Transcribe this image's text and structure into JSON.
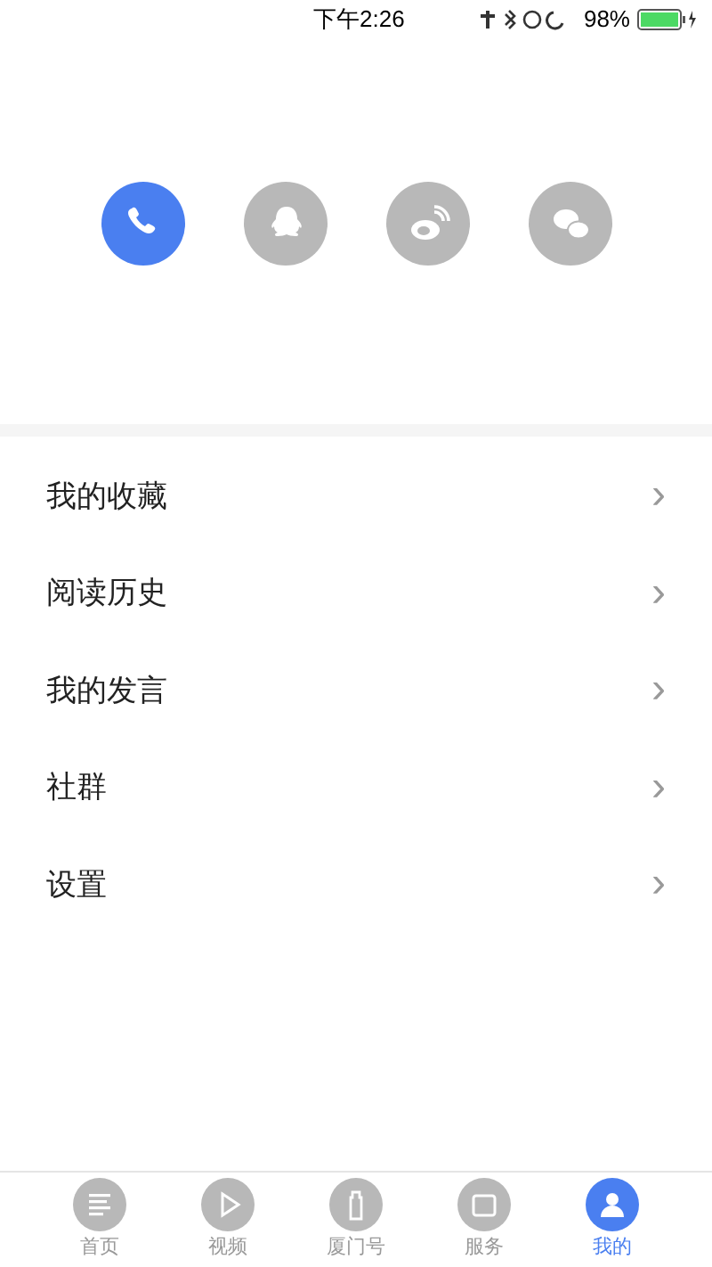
{
  "status_bar": {
    "time": "下午2:26",
    "battery": "98%"
  },
  "login_options": [
    {
      "kind": "phone",
      "selected": true
    },
    {
      "kind": "qq",
      "selected": false
    },
    {
      "kind": "weibo",
      "selected": false
    },
    {
      "kind": "wechat",
      "selected": false
    }
  ],
  "menu": [
    {
      "label": "我的收藏",
      "chevron": "›"
    },
    {
      "label": "阅读历史",
      "chevron": "›"
    },
    {
      "label": "我的发言",
      "chevron": "›"
    },
    {
      "label": "社群",
      "chevron": "›"
    },
    {
      "label": "设置",
      "chevron": "›"
    }
  ],
  "tabs": [
    {
      "kind": "home",
      "label": "首页",
      "selected": false
    },
    {
      "kind": "video",
      "label": "视频",
      "selected": false
    },
    {
      "kind": "tower",
      "label": "厦门号",
      "selected": false
    },
    {
      "kind": "service",
      "label": "服务",
      "selected": false
    },
    {
      "kind": "me",
      "label": "我的",
      "selected": true
    }
  ]
}
